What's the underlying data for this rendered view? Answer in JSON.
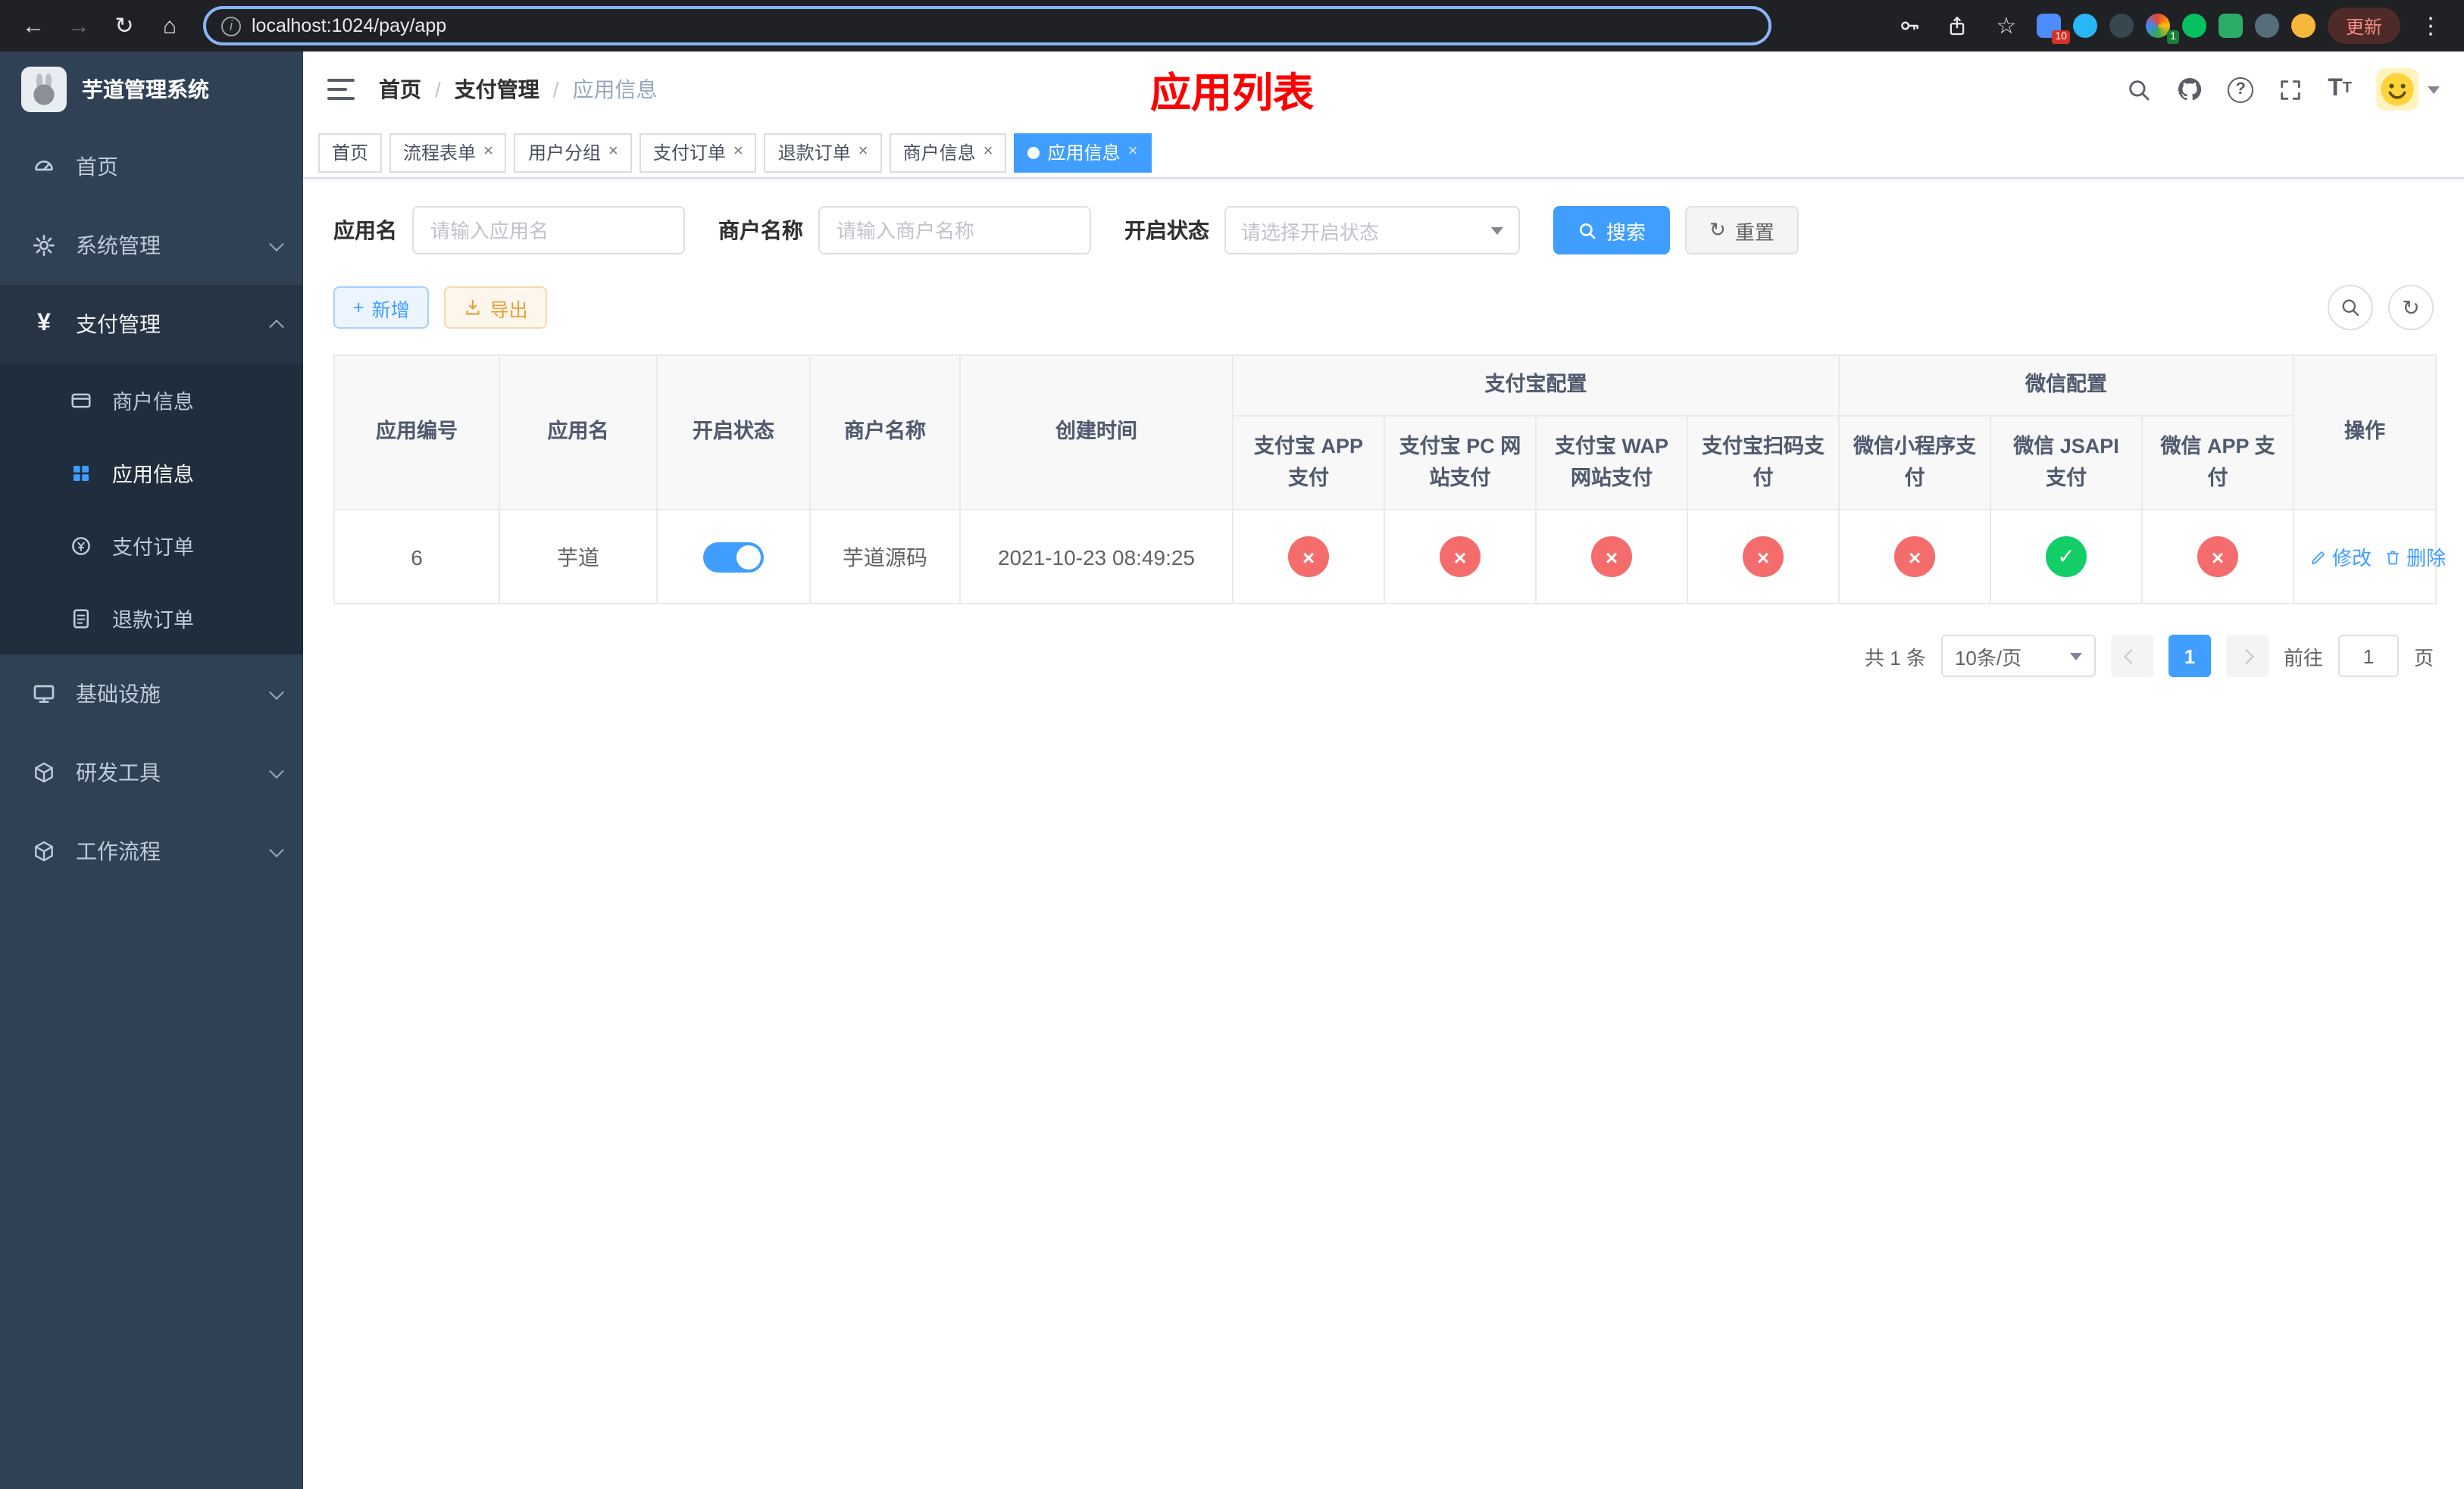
{
  "colors": {
    "accent": "#409eff",
    "success": "#13ce66",
    "danger": "#f56c6c",
    "title_red": "#ff0000",
    "sidebar_bg": "#304156"
  },
  "icons": {
    "back": "←",
    "forward": "→",
    "reload": "↻",
    "home": "⌂",
    "star": "☆",
    "dots": "⋮",
    "close": "×",
    "plus": "+",
    "refresh": "↻",
    "yen": "¥",
    "question": "?",
    "letter_t": "T",
    "letter_t_small": "T"
  },
  "browser": {
    "url": "localhost:1024/pay/app",
    "update_label": "更新",
    "ext_badge_1": "10",
    "ext_badge_2": "1"
  },
  "sidebar": {
    "logo_title": "芋道管理系统",
    "items": [
      {
        "label": "首页"
      },
      {
        "label": "系统管理"
      },
      {
        "label": "支付管理"
      },
      {
        "label": "基础设施"
      },
      {
        "label": "研发工具"
      },
      {
        "label": "工作流程"
      }
    ],
    "payment_children": [
      {
        "label": "商户信息"
      },
      {
        "label": "应用信息"
      },
      {
        "label": "支付订单"
      },
      {
        "label": "退款订单"
      }
    ]
  },
  "header": {
    "breadcrumb": [
      "首页",
      "支付管理",
      "应用信息"
    ],
    "page_title": "应用列表"
  },
  "tabs": [
    {
      "label": "首页"
    },
    {
      "label": "流程表单"
    },
    {
      "label": "用户分组"
    },
    {
      "label": "支付订单"
    },
    {
      "label": "退款订单"
    },
    {
      "label": "商户信息"
    },
    {
      "label": "应用信息"
    }
  ],
  "filters": {
    "app_name_label": "应用名",
    "app_name_placeholder": "请输入应用名",
    "merchant_label": "商户名称",
    "merchant_placeholder": "请输入商户名称",
    "status_label": "开启状态",
    "status_placeholder": "请选择开启状态",
    "search_label": "搜索",
    "reset_label": "重置"
  },
  "toolbar": {
    "add_label": "新增",
    "export_label": "导出"
  },
  "table": {
    "headers": {
      "app_id": "应用编号",
      "app_name": "应用名",
      "status": "开启状态",
      "merchant": "商户名称",
      "created": "创建时间",
      "alipay_group": "支付宝配置",
      "alipay_app": "支付宝 APP 支付",
      "alipay_pc": "支付宝 PC 网站支付",
      "alipay_wap": "支付宝 WAP 网站支付",
      "alipay_scan": "支付宝扫码支付",
      "wechat_group": "微信配置",
      "wechat_mini": "微信小程序支付",
      "wechat_jsapi": "微信 JSAPI 支付",
      "wechat_app": "微信 APP 支付",
      "actions": "操作"
    },
    "rows": [
      {
        "app_id": "6",
        "app_name": "芋道",
        "switch_state": "on",
        "merchant": "芋道源码",
        "created": "2021-10-23 08:49:25",
        "alipay_app": "fail",
        "alipay_pc": "fail",
        "alipay_wap": "fail",
        "alipay_scan": "fail",
        "wechat_mini": "fail",
        "wechat_jsapi": "success",
        "wechat_app": "fail",
        "edit_label": "修改",
        "delete_label": "删除"
      }
    ]
  },
  "pagination": {
    "total_text": "共 1 条",
    "page_size": "10条/页",
    "current_page": "1",
    "goto_label": "前往",
    "goto_value": "1",
    "page_unit": "页"
  }
}
